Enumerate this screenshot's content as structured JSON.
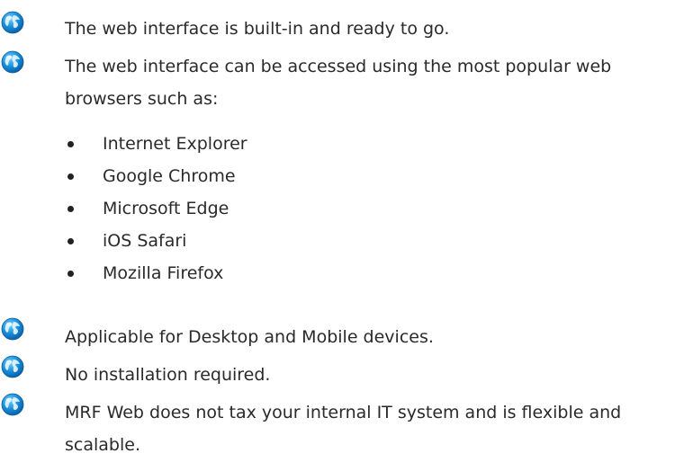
{
  "features": [
    {
      "text": "The web interface is built-in and ready to go."
    },
    {
      "text": "The web interface can be accessed using the most popular web browsers such as:"
    },
    {
      "text": "Applicable for Desktop and Mobile devices."
    },
    {
      "text": "No installation required."
    },
    {
      "text": "MRF Web does not tax your internal IT system and is flexible and scalable."
    }
  ],
  "browsers": [
    "Internet Explorer",
    "Google Chrome",
    "Microsoft Edge",
    "iOS Safari",
    "Mozilla Firefox"
  ],
  "colors": {
    "globe_blue": "#1a8fd9",
    "text": "#2a2a2a"
  },
  "icon": "globe-icon"
}
